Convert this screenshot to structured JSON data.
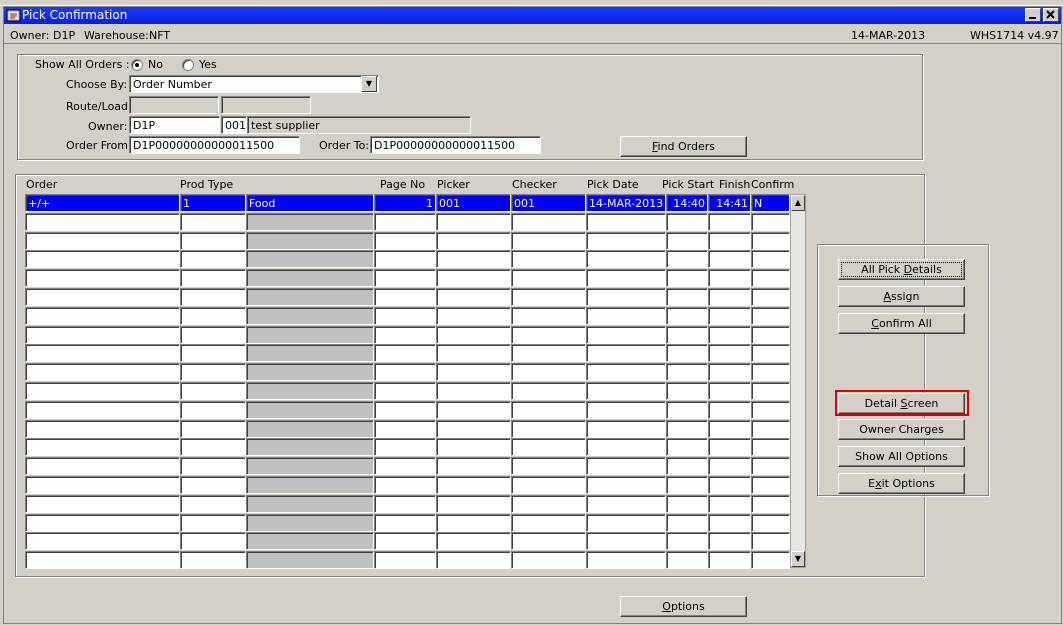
{
  "window": {
    "title": "Pick Confirmation",
    "minimize_icon": "minimize-icon",
    "close_icon": "close-icon"
  },
  "infobar": {
    "owner_label": "Owner:",
    "owner_value": "D1P",
    "warehouse_label": "Warehouse:",
    "warehouse_value": "NFT",
    "date": "14-MAR-2013",
    "version": "WHS1714  v4.97"
  },
  "criteria": {
    "show_all_orders_label": "Show All Orders :",
    "option_no": "No",
    "option_yes": "Yes",
    "selected": "No",
    "choose_by_label": "Choose By:",
    "choose_by_value": "Order Number",
    "route_load_label": "Route/Load:",
    "route_load_value1": "",
    "route_load_value2": "",
    "owner_label": "Owner:",
    "owner_value": "D1P",
    "supplier_code": "001",
    "supplier_name": "test supplier",
    "order_from_label": "Order From:",
    "order_from_value": "D1P00000000000011500",
    "order_to_label": "Order To:",
    "order_to_value": "D1P00000000000011500",
    "find_orders_button": "Find Orders"
  },
  "grid": {
    "columns": [
      "Order",
      "Prod Type",
      "Page No",
      "Picker",
      "Checker",
      "Pick Date",
      "Pick Start",
      "Finish",
      "Confirm"
    ],
    "row1": {
      "order": "+/+",
      "prod_type": "1",
      "prod_desc": "Food",
      "page_no": "1",
      "picker": "001",
      "checker": "001",
      "pick_date": "14-MAR-2013",
      "pick_start": "14:40",
      "finish": "14:41",
      "confirm": "N"
    }
  },
  "side_buttons": {
    "all_pick_details": "All Pick Details",
    "assign": "Assign",
    "confirm_all": "Confirm All",
    "detail_screen": "Detail Screen",
    "owner_charges": "Owner Charges",
    "show_all_options": "Show All Options",
    "exit_options": "Exit Options"
  },
  "bottom": {
    "options_button": "Options"
  },
  "colors": {
    "title_bar": "#0a24ff",
    "selection": "#0000ff",
    "highlight_box": "#e00000",
    "background": "#d4d0c8"
  }
}
